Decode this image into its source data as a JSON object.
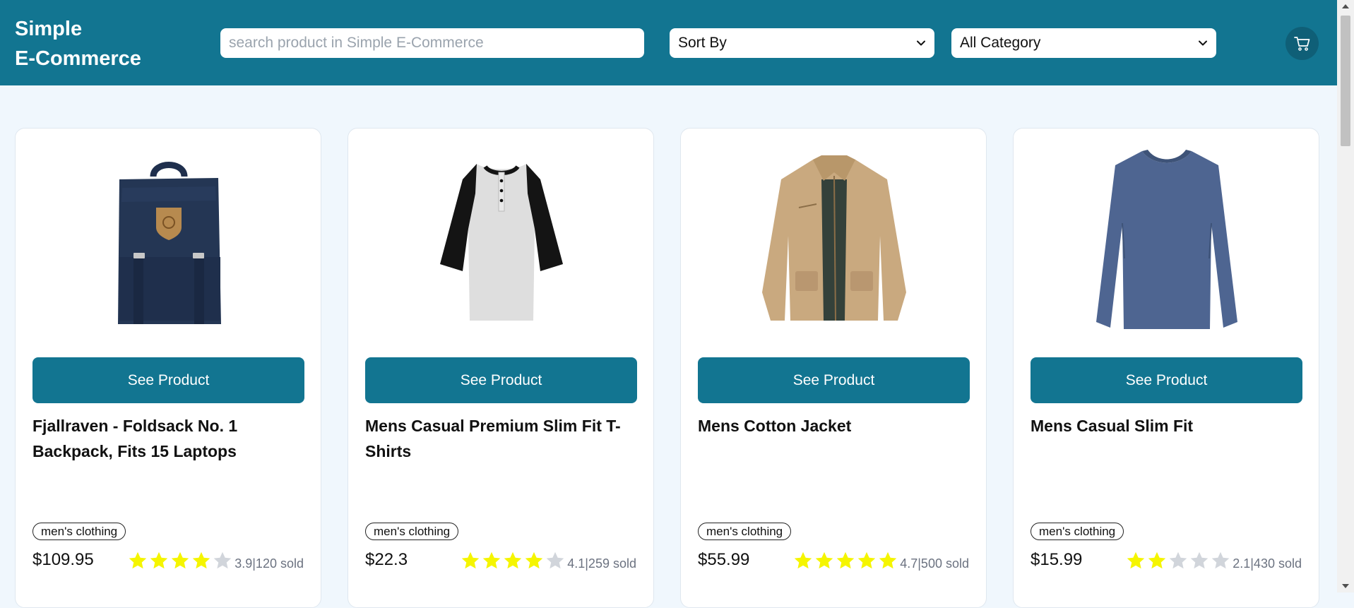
{
  "header": {
    "brand_line1": "Simple",
    "brand_line2": "E-Commerce",
    "search_placeholder": "search product in Simple E-Commerce",
    "sort_label": "Sort By",
    "category_label": "All Category",
    "cart_icon": "shopping-cart-icon"
  },
  "colors": {
    "primary": "#127591",
    "background": "#f0f7fd",
    "star_filled": "#f5f500",
    "star_empty": "#d1d5db"
  },
  "products": [
    {
      "title": "Fjallraven - Foldsack No. 1 Backpack, Fits 15 Laptops",
      "button_label": "See Product",
      "category": "men's clothing",
      "price": "$109.95",
      "rating": 3.9,
      "stars_filled": 4,
      "rating_text": "3.9|120 sold",
      "image": "backpack"
    },
    {
      "title": "Mens Casual Premium Slim Fit T-Shirts",
      "button_label": "See Product",
      "category": "men's clothing",
      "price": "$22.3",
      "rating": 4.1,
      "stars_filled": 4,
      "rating_text": "4.1|259 sold",
      "image": "raglan-tshirt"
    },
    {
      "title": "Mens Cotton Jacket",
      "button_label": "See Product",
      "category": "men's clothing",
      "price": "$55.99",
      "rating": 4.7,
      "stars_filled": 5,
      "rating_text": "4.7|500 sold",
      "image": "cotton-jacket"
    },
    {
      "title": "Mens Casual Slim Fit",
      "button_label": "See Product",
      "category": "men's clothing",
      "price": "$15.99",
      "rating": 2.1,
      "stars_filled": 2,
      "rating_text": "2.1|430 sold",
      "image": "long-sleeve-tee"
    }
  ]
}
